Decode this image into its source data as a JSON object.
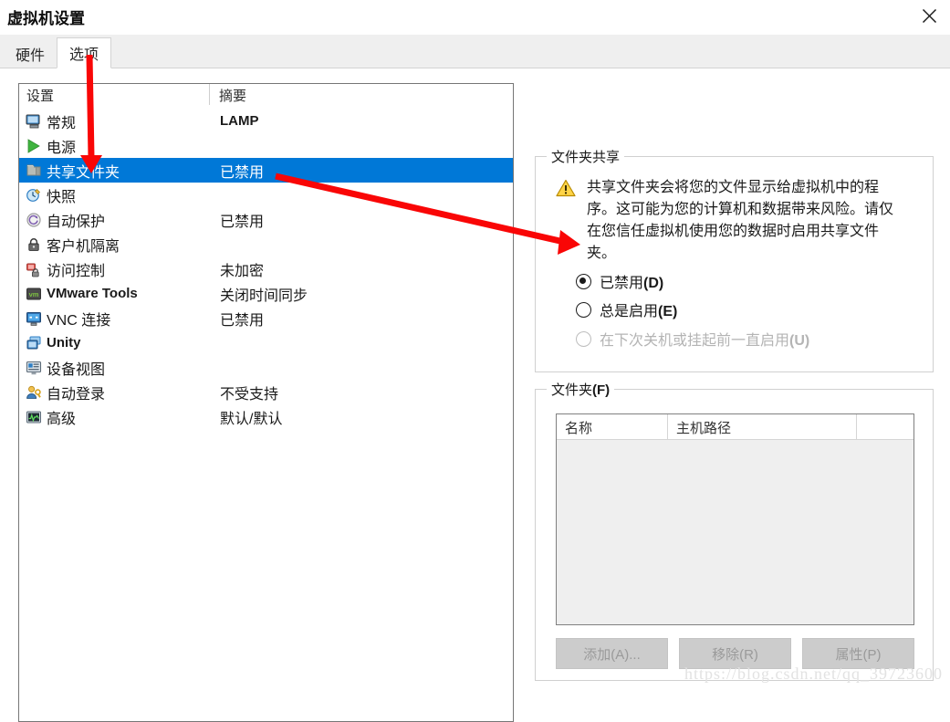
{
  "window": {
    "title": "虚拟机设置",
    "close_label": "×",
    "close_icon": "close-icon"
  },
  "tabs": [
    {
      "label": "硬件",
      "active": false
    },
    {
      "label": "选项",
      "active": true
    }
  ],
  "settings_list": {
    "headers": {
      "name": "设置",
      "summary": "摘要"
    },
    "rows": [
      {
        "icon": "monitor-icon",
        "label": "常规",
        "summary": "LAMP",
        "latin_label": false,
        "latin_summary": true,
        "selected": false
      },
      {
        "icon": "power-play-icon",
        "label": "电源",
        "summary": "",
        "latin_label": false,
        "latin_summary": false,
        "selected": false
      },
      {
        "icon": "shared-folder-icon",
        "label": "共享文件夹",
        "summary": "已禁用",
        "latin_label": false,
        "latin_summary": false,
        "selected": true
      },
      {
        "icon": "snapshot-icon",
        "label": "快照",
        "summary": "",
        "latin_label": false,
        "latin_summary": false,
        "selected": false
      },
      {
        "icon": "autoprotect-icon",
        "label": "自动保护",
        "summary": "已禁用",
        "latin_label": false,
        "latin_summary": false,
        "selected": false
      },
      {
        "icon": "lock-icon",
        "label": "客户机隔离",
        "summary": "",
        "latin_label": false,
        "latin_summary": false,
        "selected": false
      },
      {
        "icon": "access-control-icon",
        "label": "访问控制",
        "summary": "未加密",
        "latin_label": false,
        "latin_summary": false,
        "selected": false
      },
      {
        "icon": "vmware-tools-icon",
        "label": "VMware Tools",
        "summary": "关闭时间同步",
        "latin_label": true,
        "latin_summary": false,
        "selected": false
      },
      {
        "icon": "vnc-icon",
        "label": "VNC 连接",
        "summary": "已禁用",
        "latin_label": false,
        "latin_summary": false,
        "selected": false
      },
      {
        "icon": "unity-icon",
        "label": "Unity",
        "summary": "",
        "latin_label": true,
        "latin_summary": false,
        "selected": false
      },
      {
        "icon": "device-view-icon",
        "label": "设备视图",
        "summary": "",
        "latin_label": false,
        "latin_summary": false,
        "selected": false
      },
      {
        "icon": "auto-login-icon",
        "label": "自动登录",
        "summary": "不受支持",
        "latin_label": false,
        "latin_summary": false,
        "selected": false
      },
      {
        "icon": "advanced-icon",
        "label": "高级",
        "summary": "默认/默认",
        "latin_label": false,
        "latin_summary": false,
        "selected": false
      }
    ]
  },
  "folder_sharing": {
    "legend": "文件夹共享",
    "warning_icon": "warning-triangle-icon",
    "warning_text": "共享文件夹会将您的文件显示给虚拟机中的程序。这可能为您的计算机和数据带来风险。请仅在您信任虚拟机使用您的数据时启用共享文件夹。",
    "options": [
      {
        "label": "已禁用",
        "mnemonic": "(D)",
        "checked": true,
        "disabled": false
      },
      {
        "label": "总是启用",
        "mnemonic": "(E)",
        "checked": false,
        "disabled": false
      },
      {
        "label": "在下次关机或挂起前一直启用",
        "mnemonic": "(U)",
        "checked": false,
        "disabled": true
      }
    ]
  },
  "folders": {
    "legend": "文件夹",
    "legend_mnemonic": "(F)",
    "columns": [
      "名称",
      "主机路径",
      ""
    ],
    "rows": [],
    "buttons": [
      {
        "label": "添加(A)...",
        "disabled": true
      },
      {
        "label": "移除(R)",
        "disabled": true
      },
      {
        "label": "属性(P)",
        "disabled": true
      }
    ]
  },
  "annotations": {
    "arrow_color": "#f90606",
    "arrows": [
      {
        "name": "arrow-to-shared-folders-row",
        "from": [
          98,
          62
        ],
        "to": [
          100,
          184
        ]
      },
      {
        "name": "arrow-to-always-enabled-radio",
        "from": [
          302,
          193
        ],
        "to": [
          633,
          268
        ]
      }
    ]
  },
  "watermark": {
    "text": "https://blog.csdn.net/qq_39723600"
  }
}
